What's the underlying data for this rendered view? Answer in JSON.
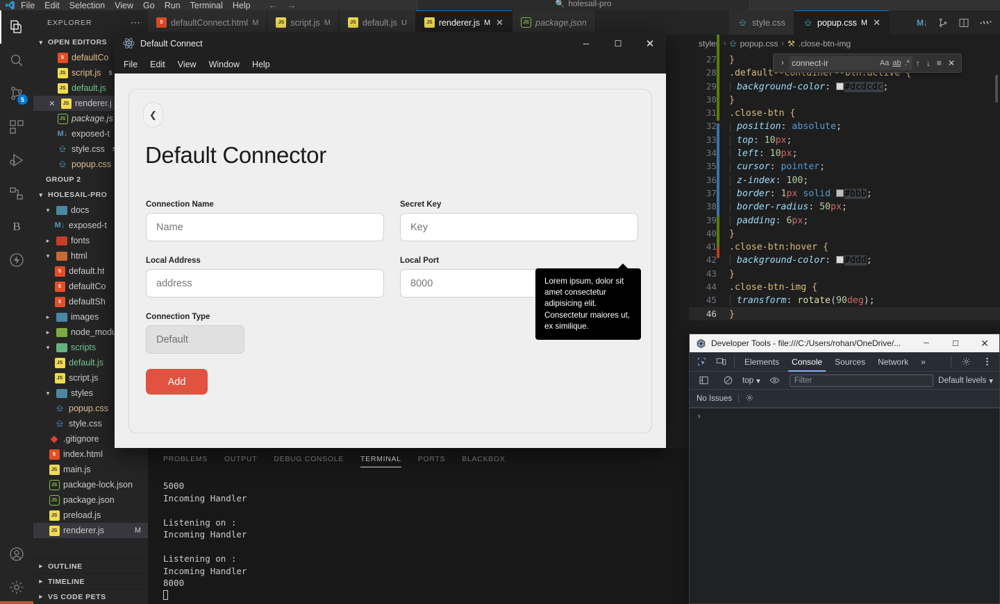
{
  "vscode": {
    "menu": [
      "File",
      "Edit",
      "Selection",
      "View",
      "Go",
      "Run",
      "Terminal",
      "Help"
    ],
    "quick_search": {
      "label": "holesail-pro",
      "icon": "search-icon"
    },
    "activity_bar": [
      {
        "name": "explorer",
        "icon": "files-icon",
        "active": true,
        "badge": ""
      },
      {
        "name": "search",
        "icon": "search-icon",
        "active": false,
        "badge": ""
      },
      {
        "name": "source-control",
        "icon": "source-control-icon",
        "active": false,
        "badge": "5"
      },
      {
        "name": "extensions",
        "icon": "extensions-icon",
        "active": false,
        "badge": ""
      },
      {
        "name": "run-and-debug",
        "icon": "run-debug-icon",
        "active": false,
        "badge": ""
      },
      {
        "name": "remote-explorer",
        "icon": "remote-explorer-icon",
        "active": false,
        "badge": ""
      },
      {
        "name": "blackbox",
        "icon": "letter-b-icon",
        "active": false,
        "badge": ""
      },
      {
        "name": "thunder-client",
        "icon": "lightning-icon",
        "active": false,
        "badge": ""
      }
    ],
    "activity_bar_bottom": [
      {
        "name": "accounts",
        "icon": "account-icon"
      },
      {
        "name": "manage-settings",
        "icon": "gear-icon"
      }
    ],
    "sidebar": {
      "title": "EXPLORER",
      "more_actions": "⋯",
      "sections": [
        {
          "label": "OPEN EDITORS",
          "expanded": true
        },
        {
          "label": "GROUP 2",
          "expanded": false,
          "no_chevron": true
        },
        {
          "label": "HOLESAIL-PRO",
          "expanded": true
        }
      ],
      "open_editors": [
        {
          "name": "defaultCo",
          "type": "html",
          "color": "nm-orange",
          "italic": false,
          "selected": false,
          "close": false,
          "badge": ""
        },
        {
          "name": "script.js",
          "type": "js",
          "color": "nm-orange",
          "italic": false,
          "selected": false,
          "close": false,
          "badge": "s"
        },
        {
          "name": "default.js",
          "type": "js",
          "color": "nm-green",
          "italic": false,
          "selected": false,
          "close": false,
          "badge": ""
        },
        {
          "name": "renderer.j",
          "type": "js",
          "color": "nm-plain",
          "italic": false,
          "selected": true,
          "close": true,
          "badge": ""
        },
        {
          "name": "package.js",
          "type": "json",
          "color": "nm-plain",
          "italic": true,
          "selected": false,
          "close": false,
          "badge": ""
        },
        {
          "name": "exposed-t",
          "type": "md",
          "color": "nm-plain",
          "italic": false,
          "selected": false,
          "close": false,
          "badge": ""
        },
        {
          "name": "style.css",
          "type": "css",
          "color": "nm-plain",
          "italic": false,
          "selected": false,
          "close": false,
          "badge": "s"
        },
        {
          "name": "popup.css",
          "type": "css",
          "color": "nm-orange",
          "italic": false,
          "selected": false,
          "close": false,
          "badge": ""
        }
      ],
      "tree": [
        {
          "name": "docs",
          "kind": "folder",
          "indent": 1,
          "expanded": true,
          "folder_color": "#519aba",
          "color": "nm-plain"
        },
        {
          "name": "exposed-t",
          "kind": "md",
          "indent": 3,
          "color": "nm-plain"
        },
        {
          "name": "fonts",
          "kind": "folder",
          "indent": 1,
          "expanded": false,
          "folder_color": "#e24329",
          "color": "nm-plain"
        },
        {
          "name": "html",
          "kind": "folder",
          "indent": 1,
          "expanded": true,
          "folder_color": "#e37933",
          "color": "nm-plain"
        },
        {
          "name": "default.ht",
          "kind": "html",
          "indent": 3,
          "color": "nm-plain"
        },
        {
          "name": "defaultCo",
          "kind": "html",
          "indent": 3,
          "color": "nm-plain"
        },
        {
          "name": "defaultSh",
          "kind": "html",
          "indent": 3,
          "color": "nm-plain"
        },
        {
          "name": "images",
          "kind": "folder",
          "indent": 1,
          "expanded": false,
          "folder_color": "#519aba",
          "color": "nm-plain"
        },
        {
          "name": "node_modu",
          "kind": "folder",
          "indent": 1,
          "expanded": false,
          "folder_color": "#8dc149",
          "color": "nm-plain"
        },
        {
          "name": "scripts",
          "kind": "folder",
          "indent": 1,
          "expanded": true,
          "folder_color": "#73c991",
          "color": "nm-green"
        },
        {
          "name": "default.js",
          "kind": "js",
          "indent": 3,
          "color": "nm-green"
        },
        {
          "name": "script.js",
          "kind": "js",
          "indent": 3,
          "color": "nm-plain"
        },
        {
          "name": "styles",
          "kind": "folder",
          "indent": 1,
          "expanded": true,
          "folder_color": "#519aba",
          "color": "nm-plain"
        },
        {
          "name": "popup.css",
          "kind": "css",
          "indent": 3,
          "color": "nm-orange"
        },
        {
          "name": "style.css",
          "kind": "css",
          "indent": 3,
          "color": "nm-plain"
        },
        {
          "name": ".gitignore",
          "kind": "git",
          "indent": 2,
          "color": "nm-plain"
        },
        {
          "name": "index.html",
          "kind": "html",
          "indent": 2,
          "color": "nm-plain"
        },
        {
          "name": "main.js",
          "kind": "js",
          "indent": 2,
          "color": "nm-plain"
        },
        {
          "name": "package-lock.json",
          "kind": "json",
          "indent": 2,
          "color": "nm-plain"
        },
        {
          "name": "package.json",
          "kind": "json",
          "indent": 2,
          "color": "nm-plain"
        },
        {
          "name": "preload.js",
          "kind": "js",
          "indent": 2,
          "color": "nm-plain"
        },
        {
          "name": "renderer.js",
          "kind": "js",
          "indent": 2,
          "color": "nm-plain",
          "selected": true,
          "badge": "M"
        }
      ],
      "bottom_sections": [
        {
          "label": "OUTLINE"
        },
        {
          "label": "TIMELINE"
        },
        {
          "label": "VS CODE PETS"
        }
      ]
    },
    "tabs_group1": [
      {
        "label": "defaultConnect.html",
        "type": "html",
        "state": "M",
        "active": false,
        "close": false,
        "italic": false
      },
      {
        "label": "script.js",
        "type": "js",
        "state": "M",
        "active": false,
        "close": false,
        "italic": false
      },
      {
        "label": "default.js",
        "type": "js",
        "state": "U",
        "active": false,
        "close": false,
        "italic": false
      },
      {
        "label": "renderer.js",
        "type": "js",
        "state": "M",
        "active": true,
        "close": true,
        "italic": false
      },
      {
        "label": "package.json",
        "type": "json",
        "state": "",
        "active": false,
        "close": false,
        "italic": true
      }
    ],
    "tab_actions": [
      "markdown-preview-icon",
      "split-editor-vertical-icon",
      "split-editor-icon",
      "more-actions-icon"
    ],
    "tabs_group2": [
      {
        "label": "style.css",
        "type": "css",
        "state": "",
        "active": false,
        "close": false
      },
      {
        "label": "popup.css",
        "type": "css",
        "state": "M",
        "active": true,
        "close": true
      }
    ],
    "breadcrumb": [
      "styles",
      "popup.css",
      ".close-btn-img"
    ],
    "find_widget": {
      "query": "connect-ir",
      "match_case": "Aa",
      "whole_word": "ab",
      "regex": ".*",
      "prev": "↑",
      "next": "↓",
      "find_in_selection": "≡",
      "close": "✕"
    },
    "code": {
      "language": "css",
      "lines": [
        {
          "n": 27,
          "tokens": [
            {
              "t": "}",
              "c": "k-brace"
            }
          ],
          "indent": false
        },
        {
          "n": 28,
          "tokens": [
            {
              "t": ".default--container--btn:active ",
              "c": "k-sel"
            },
            {
              "t": "{",
              "c": "k-brace"
            }
          ],
          "indent": false
        },
        {
          "n": 29,
          "tokens": [
            {
              "t": "background-color",
              "c": "k-prop"
            },
            {
              "t": ": ",
              "c": "k-punc"
            },
            {
              "t": "#dcdcdc",
              "c": "swatch"
            },
            {
              "t": ";",
              "c": "k-punc"
            }
          ],
          "indent": true
        },
        {
          "n": 30,
          "tokens": [
            {
              "t": "}",
              "c": "k-brace"
            }
          ],
          "indent": false
        },
        {
          "n": 31,
          "tokens": [
            {
              "t": ".close-btn ",
              "c": "k-sel"
            },
            {
              "t": "{",
              "c": "k-brace"
            }
          ],
          "indent": false
        },
        {
          "n": 32,
          "tokens": [
            {
              "t": "position",
              "c": "k-prop"
            },
            {
              "t": ": ",
              "c": "k-punc"
            },
            {
              "t": "absolute",
              "c": "k-kw"
            },
            {
              "t": ";",
              "c": "k-punc"
            }
          ],
          "indent": true
        },
        {
          "n": 33,
          "tokens": [
            {
              "t": "top",
              "c": "k-prop"
            },
            {
              "t": ": ",
              "c": "k-punc"
            },
            {
              "t": "10",
              "c": "k-num"
            },
            {
              "t": "px",
              "c": "k-unit"
            },
            {
              "t": ";",
              "c": "k-punc"
            }
          ],
          "indent": true
        },
        {
          "n": 34,
          "tokens": [
            {
              "t": "left",
              "c": "k-prop"
            },
            {
              "t": ": ",
              "c": "k-punc"
            },
            {
              "t": "10",
              "c": "k-num"
            },
            {
              "t": "px",
              "c": "k-unit"
            },
            {
              "t": ";",
              "c": "k-punc"
            }
          ],
          "indent": true
        },
        {
          "n": 35,
          "tokens": [
            {
              "t": "cursor",
              "c": "k-prop"
            },
            {
              "t": ": ",
              "c": "k-punc"
            },
            {
              "t": "pointer",
              "c": "k-kw"
            },
            {
              "t": ";",
              "c": "k-punc"
            }
          ],
          "indent": true
        },
        {
          "n": 36,
          "tokens": [
            {
              "t": "z-index",
              "c": "k-prop"
            },
            {
              "t": ": ",
              "c": "k-punc"
            },
            {
              "t": "100",
              "c": "k-num"
            },
            {
              "t": ";",
              "c": "k-punc"
            }
          ],
          "indent": true
        },
        {
          "n": 37,
          "tokens": [
            {
              "t": "border",
              "c": "k-prop"
            },
            {
              "t": ": ",
              "c": "k-punc"
            },
            {
              "t": "1",
              "c": "k-num"
            },
            {
              "t": "px",
              "c": "k-unit"
            },
            {
              "t": " solid ",
              "c": "k-kw"
            },
            {
              "t": "#bbb",
              "c": "swatch"
            },
            {
              "t": ";",
              "c": "k-punc"
            }
          ],
          "indent": true
        },
        {
          "n": 38,
          "tokens": [
            {
              "t": "border-radius",
              "c": "k-prop"
            },
            {
              "t": ": ",
              "c": "k-punc"
            },
            {
              "t": "50",
              "c": "k-num"
            },
            {
              "t": "px",
              "c": "k-unit"
            },
            {
              "t": ";",
              "c": "k-punc"
            }
          ],
          "indent": true
        },
        {
          "n": 39,
          "tokens": [
            {
              "t": "padding",
              "c": "k-prop"
            },
            {
              "t": ": ",
              "c": "k-punc"
            },
            {
              "t": "6",
              "c": "k-num"
            },
            {
              "t": "px",
              "c": "k-unit"
            },
            {
              "t": ";",
              "c": "k-punc"
            }
          ],
          "indent": true
        },
        {
          "n": 40,
          "tokens": [
            {
              "t": "}",
              "c": "k-brace"
            }
          ],
          "indent": false
        },
        {
          "n": 41,
          "tokens": [
            {
              "t": ".close-btn:hover ",
              "c": "k-sel"
            },
            {
              "t": "{",
              "c": "k-brace"
            }
          ],
          "indent": false
        },
        {
          "n": 42,
          "tokens": [
            {
              "t": "background-color",
              "c": "k-prop"
            },
            {
              "t": ": ",
              "c": "k-punc"
            },
            {
              "t": "#ddd",
              "c": "swatch"
            },
            {
              "t": ";",
              "c": "k-punc"
            }
          ],
          "indent": true
        },
        {
          "n": 43,
          "tokens": [
            {
              "t": "}",
              "c": "k-brace"
            }
          ],
          "indent": false
        },
        {
          "n": 44,
          "tokens": [
            {
              "t": ".close-btn-img ",
              "c": "k-sel"
            },
            {
              "t": "{",
              "c": "k-brace"
            }
          ],
          "indent": false
        },
        {
          "n": 45,
          "tokens": [
            {
              "t": "transform",
              "c": "k-prop"
            },
            {
              "t": ": ",
              "c": "k-punc"
            },
            {
              "t": "rotate",
              "c": "k-fn"
            },
            {
              "t": "(",
              "c": "k-punc"
            },
            {
              "t": "90",
              "c": "k-num"
            },
            {
              "t": "deg",
              "c": "k-unit"
            },
            {
              "t": ")",
              "c": "k-punc"
            },
            {
              "t": ";",
              "c": "k-punc"
            }
          ],
          "indent": true
        },
        {
          "n": 46,
          "tokens": [
            {
              "t": "}",
              "c": "k-brace"
            }
          ],
          "indent": false,
          "current": true
        }
      ],
      "first_visible_line": 16
    },
    "panel": {
      "tabs": [
        "PROBLEMS",
        "OUTPUT",
        "DEBUG CONSOLE",
        "TERMINAL",
        "PORTS",
        "BLACKBOX"
      ],
      "active_tab": "TERMINAL",
      "terminal_output": "5000\nIncoming Handler\n\nListening on :\nIncoming Handler\n\nListening on :\nIncoming Handler\n8000\n"
    }
  },
  "dialog": {
    "title": "Default Connect",
    "app_icon": "electron-icon",
    "window_buttons": {
      "minimize": "─",
      "maximize": "☐",
      "close": "✕"
    },
    "menu": [
      "File",
      "Edit",
      "View",
      "Window",
      "Help"
    ],
    "back_button_icon": "chevron-left-icon",
    "heading": "Default Connector",
    "fields": [
      {
        "label": "Connection Name",
        "placeholder": "Name",
        "value": "",
        "disabled": false,
        "name": "connection-name"
      },
      {
        "label": "Secret Key",
        "placeholder": "Key",
        "value": "",
        "disabled": false,
        "name": "secret-key"
      },
      {
        "label": "Local Address",
        "placeholder": "address",
        "value": "",
        "disabled": false,
        "name": "local-address"
      },
      {
        "label": "Local Port",
        "placeholder": "8000",
        "value": "",
        "disabled": false,
        "name": "local-port"
      },
      {
        "label": "Connection Type",
        "placeholder": "Default",
        "value": "Default",
        "disabled": true,
        "name": "connection-type"
      }
    ],
    "submit_label": "Add",
    "submit_color": "#e15241",
    "tooltip": "Lorem ipsum, dolor sit amet consectetur adipisicing elit. Consectetur maiores ut, ex similique."
  },
  "devtools": {
    "window_title": "Developer Tools - file:///C:/Users/rohan/OneDrive/...",
    "app_icon": "devtools-icon",
    "window_buttons": {
      "minimize": "─",
      "maximize": "☐",
      "close": "✕"
    },
    "left_icons": [
      "inspect-element-icon",
      "device-toolbar-icon"
    ],
    "tabs": [
      "Elements",
      "Console",
      "Sources",
      "Network"
    ],
    "active_tab": "Console",
    "more_tabs": "»",
    "right_icons": [
      "gear-icon",
      "more-options-icon"
    ],
    "toolbar": {
      "sidebar_toggle_icon": "console-sidebar-icon",
      "clear_icon": "clear-console-icon",
      "context": "top",
      "eye_icon": "live-expression-icon",
      "filter_placeholder": "Filter",
      "levels": "Default levels"
    },
    "issues_label": "No Issues",
    "issues_gear_icon": "gear-icon",
    "prompt": "›"
  }
}
